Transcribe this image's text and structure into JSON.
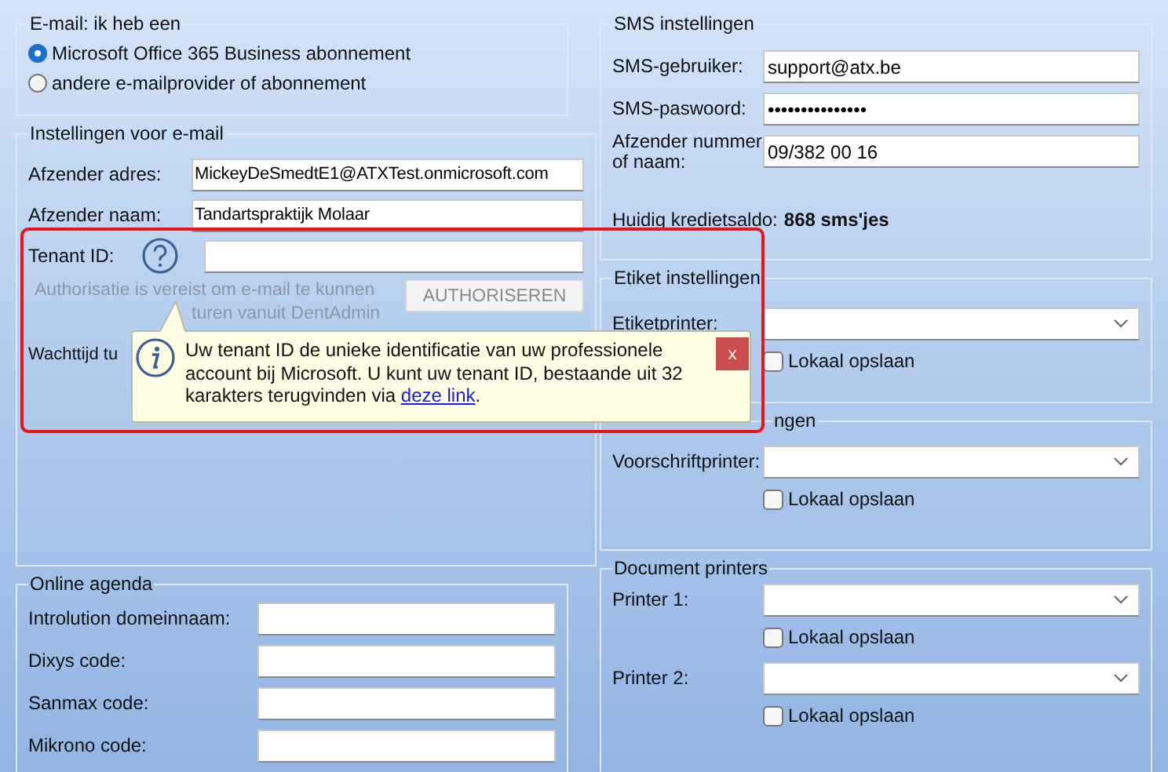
{
  "email_provider": {
    "title": "E-mail: ik heb een",
    "options": [
      {
        "label": "Microsoft Office 365 Business abonnement",
        "selected": true
      },
      {
        "label": "andere e-mailprovider of abonnement",
        "selected": false
      }
    ]
  },
  "email_settings": {
    "title": "Instellingen voor e-mail",
    "fields": [
      {
        "label": "Afzender adres:",
        "value": "MickeyDeSmedtE1@ATXTest.onmicrosoft.com"
      },
      {
        "label": "Afzender naam:",
        "value": "Tandartspraktijk Molaar"
      }
    ],
    "tenant_label": "Tenant ID:",
    "auth_note": [
      "Authorisatie is vereist om e-mail te kunnen",
      "turen vanuit DentAdmin"
    ],
    "auth_button": {
      "label": "AUTHORISEREN",
      "disabled": true
    },
    "wait_label": "Wachttijd tu"
  },
  "online_agenda": {
    "title": "Online agenda",
    "fields": [
      {
        "label": "Introlution domeinnaam:"
      },
      {
        "label": "Dixys code:"
      },
      {
        "label": "Sanmax code:"
      },
      {
        "label": "Mikrono code:"
      }
    ]
  },
  "sms": {
    "title": "SMS instellingen",
    "fields": [
      {
        "label": "SMS-gebruiker:",
        "value": "support@atx.be"
      },
      {
        "label": "SMS-paswoord:",
        "value": "•••••••••••••••"
      },
      {
        "label": "Afzender nummer of naam:",
        "value": "09/382 00 16"
      }
    ],
    "credit_label": "Huidig kredietsaldo:",
    "credit_value": "868 sms'jes"
  },
  "label_printer": {
    "title": "Etiket instellingen",
    "printers": [
      {
        "label": "Etiketprinter:",
        "local_save": {
          "label": "Lokaal opslaan",
          "checked": false
        }
      }
    ]
  },
  "prescription_printer": {
    "title": "ngen",
    "printers": [
      {
        "label": "Voorschriftprinter:",
        "local_save": {
          "label": "Lokaal opslaan",
          "checked": false
        }
      }
    ]
  },
  "document_printers": {
    "title": "Document printers",
    "printers": [
      {
        "label": "Printer 1:",
        "local_save": {
          "label": "Lokaal opslaan",
          "checked": false
        }
      },
      {
        "label": "Printer 2:",
        "local_save": {
          "label": "Lokaal opslaan",
          "checked": false
        }
      }
    ]
  },
  "tooltip": {
    "text": "Uw tenant ID de unieke identificatie van uw professionele account bij Microsoft. U kunt uw tenant ID, bestaande uit 32 karakters terugvinden via",
    "link": "deze link",
    "after": ".",
    "close": "x"
  }
}
